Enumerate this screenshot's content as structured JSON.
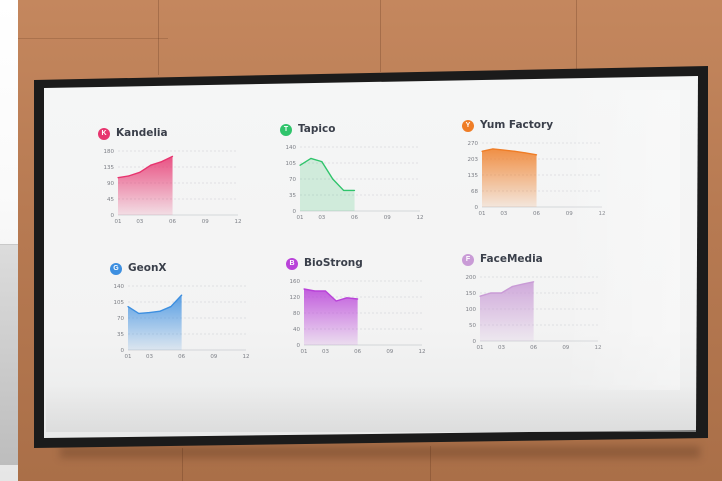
{
  "scene": {
    "description_colors": {
      "wall": "#b77a52",
      "bezel": "#1b1b1b",
      "screen": "#f3f3f3"
    }
  },
  "dashboard": {
    "panels": [
      {
        "id": "kandelia",
        "title": "Kandelia",
        "icon": "kandelia-logo-icon",
        "icon_glyph": "K",
        "color": "#e7356f",
        "yticks": [
          "180",
          "135",
          "90",
          "45",
          "0"
        ],
        "xticks": [
          "01",
          "03",
          "06",
          "09",
          "12"
        ],
        "chart_data": {
          "type": "area",
          "title": "Kandelia",
          "x": [
            1,
            2,
            3,
            4,
            5,
            6
          ],
          "values": [
            105,
            110,
            120,
            140,
            150,
            165
          ],
          "ylim": [
            0,
            180
          ],
          "xlim": [
            1,
            12
          ]
        }
      },
      {
        "id": "tapico",
        "title": "Tapico",
        "icon": "tapico-logo-icon",
        "icon_glyph": "T",
        "color": "#2fc46b",
        "yticks": [
          "140",
          "105",
          "70",
          "35",
          "0"
        ],
        "xticks": [
          "01",
          "03",
          "06",
          "09",
          "12"
        ],
        "chart_data": {
          "type": "line",
          "title": "Tapico",
          "x": [
            1,
            2,
            3,
            4,
            5,
            6
          ],
          "values": [
            100,
            115,
            108,
            70,
            45,
            45
          ],
          "ylim": [
            0,
            140
          ],
          "xlim": [
            1,
            12
          ]
        }
      },
      {
        "id": "yum-factory",
        "title": "Yum Factory",
        "icon": "yum-factory-logo-icon",
        "icon_glyph": "Y",
        "color": "#ef7d26",
        "yticks": [
          "270",
          "203",
          "135",
          "68",
          "0"
        ],
        "xticks": [
          "01",
          "03",
          "06",
          "09",
          "12"
        ],
        "chart_data": {
          "type": "area",
          "title": "Yum Factory",
          "x": [
            1,
            2,
            3,
            4,
            5,
            6
          ],
          "values": [
            235,
            245,
            240,
            235,
            228,
            220
          ],
          "ylim": [
            0,
            270
          ],
          "xlim": [
            1,
            12
          ]
        }
      },
      {
        "id": "geonx",
        "title": "GeonX",
        "icon": "geonx-logo-icon",
        "icon_glyph": "G",
        "color": "#3d8fe0",
        "yticks": [
          "140",
          "105",
          "70",
          "35",
          "0"
        ],
        "xticks": [
          "01",
          "03",
          "06",
          "09",
          "12"
        ],
        "chart_data": {
          "type": "area",
          "title": "GeonX",
          "x": [
            1,
            2,
            3,
            4,
            5,
            6
          ],
          "values": [
            95,
            80,
            82,
            85,
            95,
            120
          ],
          "ylim": [
            0,
            140
          ],
          "xlim": [
            1,
            12
          ]
        }
      },
      {
        "id": "biostrong",
        "title": "BioStrong",
        "icon": "biostrong-logo-icon",
        "icon_glyph": "B",
        "color": "#b942d9",
        "yticks": [
          "160",
          "120",
          "80",
          "40",
          "0"
        ],
        "xticks": [
          "01",
          "03",
          "06",
          "09",
          "12"
        ],
        "chart_data": {
          "type": "area",
          "title": "BioStrong",
          "x": [
            1,
            2,
            3,
            4,
            5,
            6
          ],
          "values": [
            140,
            135,
            135,
            110,
            118,
            115
          ],
          "ylim": [
            0,
            160
          ],
          "xlim": [
            1,
            12
          ]
        }
      },
      {
        "id": "facemedia",
        "title": "FaceMedia",
        "icon": "facemedia-logo-icon",
        "icon_glyph": "F",
        "color": "#c99bd6",
        "yticks": [
          "200",
          "150",
          "100",
          "50",
          "0"
        ],
        "xticks": [
          "01",
          "03",
          "06",
          "09",
          "12"
        ],
        "chart_data": {
          "type": "area",
          "title": "FaceMedia",
          "x": [
            1,
            2,
            3,
            4,
            5,
            6
          ],
          "values": [
            140,
            150,
            150,
            170,
            178,
            185
          ],
          "ylim": [
            0,
            200
          ],
          "xlim": [
            1,
            12
          ]
        }
      }
    ]
  }
}
